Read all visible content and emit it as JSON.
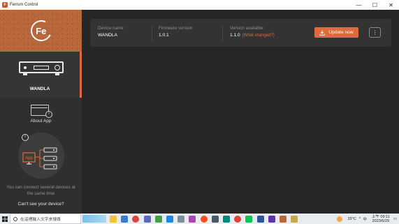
{
  "window": {
    "title": "Ferrum Control",
    "minimize": "—",
    "maximize": "☐",
    "close": "✕"
  },
  "brand": {
    "logo_text": "Fe"
  },
  "sidebar": {
    "items": [
      {
        "label": "WANDLA",
        "active": true
      },
      {
        "label": "About App",
        "active": false
      }
    ],
    "multi_device": {
      "info_glyph": "i",
      "app_label": "App"
    },
    "hint_text": "You can connect several devices at the same time",
    "cant_see_text": "Can't see your device?"
  },
  "device": {
    "name_label": "Device name",
    "name_value": "WANDLA",
    "firmware_label": "Firmware version",
    "firmware_value": "1.0.1",
    "available_label": "Version available",
    "available_value": "1.1.0",
    "what_changed": "(What changed?)",
    "update_button": "Update now",
    "more_glyph": "⋮"
  },
  "taskbar": {
    "search_placeholder": "在這裡輸入文字來搜尋",
    "temperature": "33°C",
    "ime": "中",
    "time_period": "上午 09:11",
    "date": "2023/6/29"
  },
  "colors": {
    "accent": "#e06a3c",
    "sidebar": "#2f2f2f",
    "main": "#262626",
    "card": "#333333"
  }
}
